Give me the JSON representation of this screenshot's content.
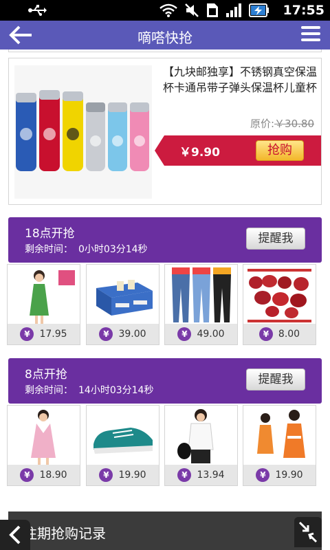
{
  "status": {
    "time": "17:55"
  },
  "header": {
    "title": "嘀嗒快抢"
  },
  "deal": {
    "name": "【九块邮独享】不锈钢真空保温杯卡通吊带子弹头保温杯儿童杯",
    "orig_label": "原价:",
    "orig_price": "￥30.80",
    "sale_price": "￥9.90",
    "buy_label": "抢购"
  },
  "sessions": [
    {
      "title": "18点开抢",
      "remain_label": "剩余时间：",
      "remain_value": "0小时03分14秒",
      "remind_label": "提醒我",
      "items": [
        {
          "price": "17.95",
          "icon": "dress-image"
        },
        {
          "price": "39.00",
          "icon": "storage-box-image"
        },
        {
          "price": "49.00",
          "icon": "jeans-image"
        },
        {
          "price": "8.00",
          "icon": "jujube-image"
        }
      ]
    },
    {
      "title": "8点开抢",
      "remain_label": "剩余时间：",
      "remain_value": "14小时03分14秒",
      "remind_label": "提醒我",
      "items": [
        {
          "price": "18.90",
          "icon": "pink-dress-image"
        },
        {
          "price": "19.90",
          "icon": "shoe-image"
        },
        {
          "price": "13.94",
          "icon": "tshirt-image"
        },
        {
          "price": "19.90",
          "icon": "kids-dress-image"
        }
      ]
    }
  ],
  "yen_symbol": "¥",
  "footer": {
    "history_label": "往期抢购记录"
  },
  "colors": {
    "header": "#5a59b8",
    "session": "#6a2fa0",
    "sale_band": "#cc1b3f",
    "accent": "#7a3aa8"
  }
}
